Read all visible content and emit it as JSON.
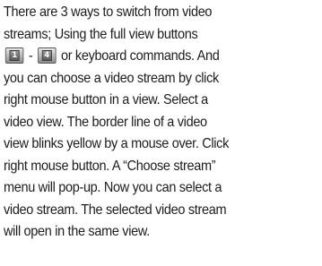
{
  "paragraph": {
    "line1": "There are 3 ways to switch from video",
    "line2": "streams; Using the full view buttons",
    "line3_between": " - ",
    "line3_after": " or keyboard commands. And",
    "line4": "you can choose a video stream by click",
    "line5": "right mouse button in a view. Select a",
    "line6": "video view. The border line of a video",
    "line7": "view blinks yellow by a mouse over. Click",
    "line8": "right mouse button. A “Choose stream”",
    "line9": "menu will pop-up. Now you can select a",
    "line10": "video stream. The selected video stream",
    "line11": "will open in the same view."
  },
  "icons": {
    "first": {
      "name": "full-view-1-icon",
      "label": "1"
    },
    "second": {
      "name": "full-view-4-icon",
      "label": "4"
    }
  }
}
